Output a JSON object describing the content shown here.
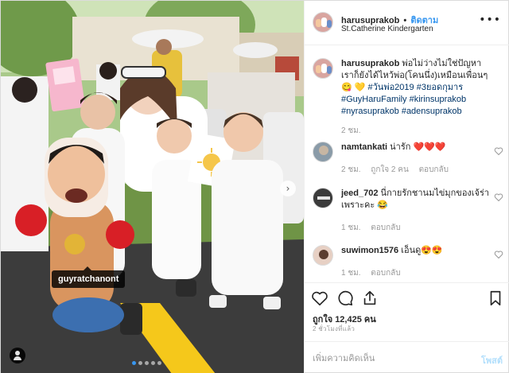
{
  "post": {
    "username": "harusuprakob",
    "separator": "•",
    "follow_label": "ติดตาม",
    "location": "St.Catherine Kindergarten",
    "more_label": "•••",
    "photo_tag": "guyratchanont",
    "carousel": {
      "count": 5,
      "active": 0
    },
    "next_label": "›"
  },
  "caption": {
    "username": "harusuprakob",
    "text": "พ่อไม่ว่างไม่ใช่ปัญหา เราก็ยังได้ไหว้พ่อ(โคนนึ่ง)เหมือนเพื่อนๆ 😋 💛 ",
    "tags": "#วันพ่อ2019 #3ยอดกุมาร #GuyHaruFamily #kirinsuprakob #nyrasuprakob #adensuprakob",
    "age": "2 ชม."
  },
  "comments": [
    {
      "username": "namtankati",
      "text": "น่ารัก ❤️❤️❤️",
      "age": "2 ชม.",
      "likes": "ถูกใจ 2 คน",
      "reply": "ตอบกลับ"
    },
    {
      "username": "jeed_702",
      "text": "นี่กายรักชานมไข่มุกของเจ้ร่าเพราะคะ 😂",
      "age": "1 ชม.",
      "likes": "",
      "reply": "ตอบกลับ"
    },
    {
      "username": "suwimon1576",
      "text": "เอ็นดู😍😍",
      "age": "1 ชม.",
      "likes": "",
      "reply": "ตอบกลับ"
    }
  ],
  "likes_text": "ถูกใจ 12,425 คน",
  "timestamp": "2 ชั่วโมงที่แล้ว",
  "add_comment": {
    "placeholder": "เพิ่มความคิดเห็น",
    "post_label": "โพสต์"
  },
  "colors": {
    "link": "#3897f0",
    "hashtag": "#003569",
    "muted": "#999999",
    "heart": "#ed4956"
  },
  "icons": [
    "heart-icon",
    "comment-icon",
    "share-icon",
    "bookmark-icon",
    "user-tag-icon",
    "more-icon",
    "chevron-right-icon"
  ]
}
